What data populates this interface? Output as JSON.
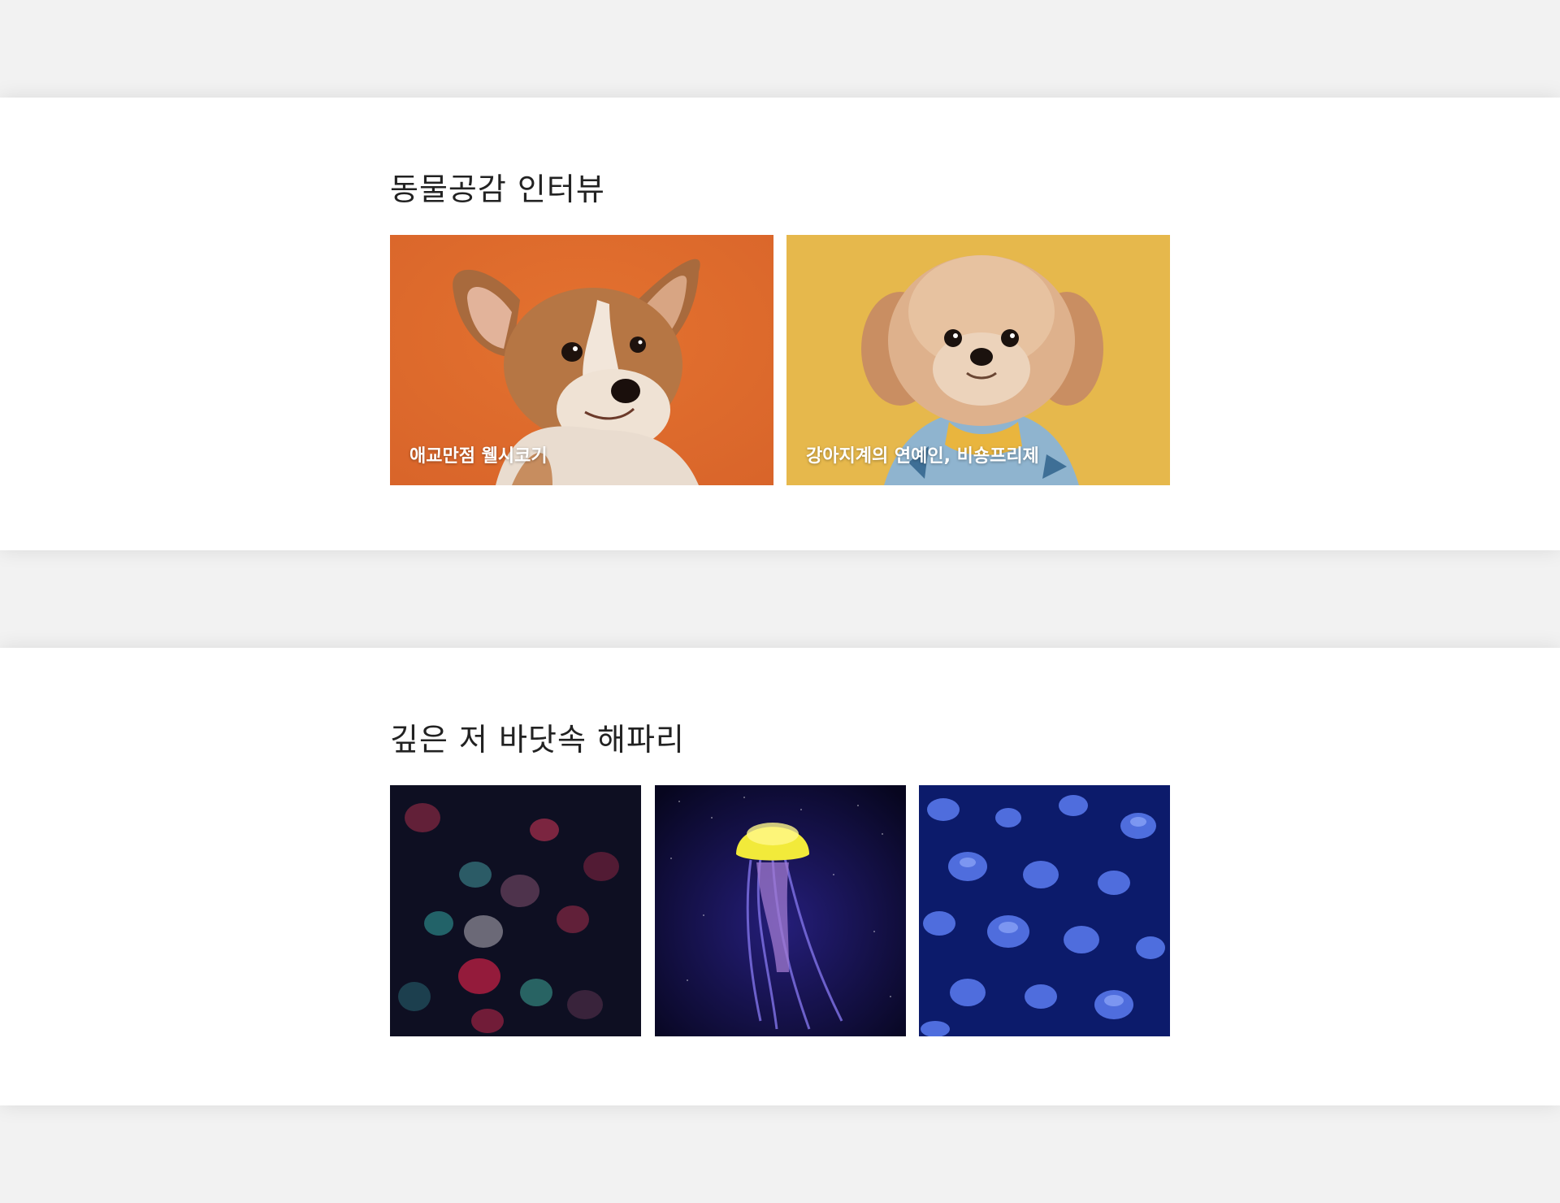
{
  "sections": [
    {
      "title": "동물공감 인터뷰",
      "cards": [
        {
          "caption": "애교만점 웰시코기",
          "image": "welsh-corgi-photo",
          "bg": "#de6a2c"
        },
        {
          "caption": "강아지계의 연예인, 비숑프리제",
          "image": "bichon-frise-photo",
          "bg": "#e6b84c"
        }
      ]
    },
    {
      "title": "깊은 저 바닷속 해파리",
      "tiles": [
        {
          "image": "jellyfish-swarm-pink-teal-photo",
          "bg": "#0e0f22"
        },
        {
          "image": "glowing-yellow-jellyfish-photo",
          "bg": "#0b0a33"
        },
        {
          "image": "blue-jellyfish-swarm-photo",
          "bg": "#0c1b6b"
        }
      ]
    }
  ]
}
